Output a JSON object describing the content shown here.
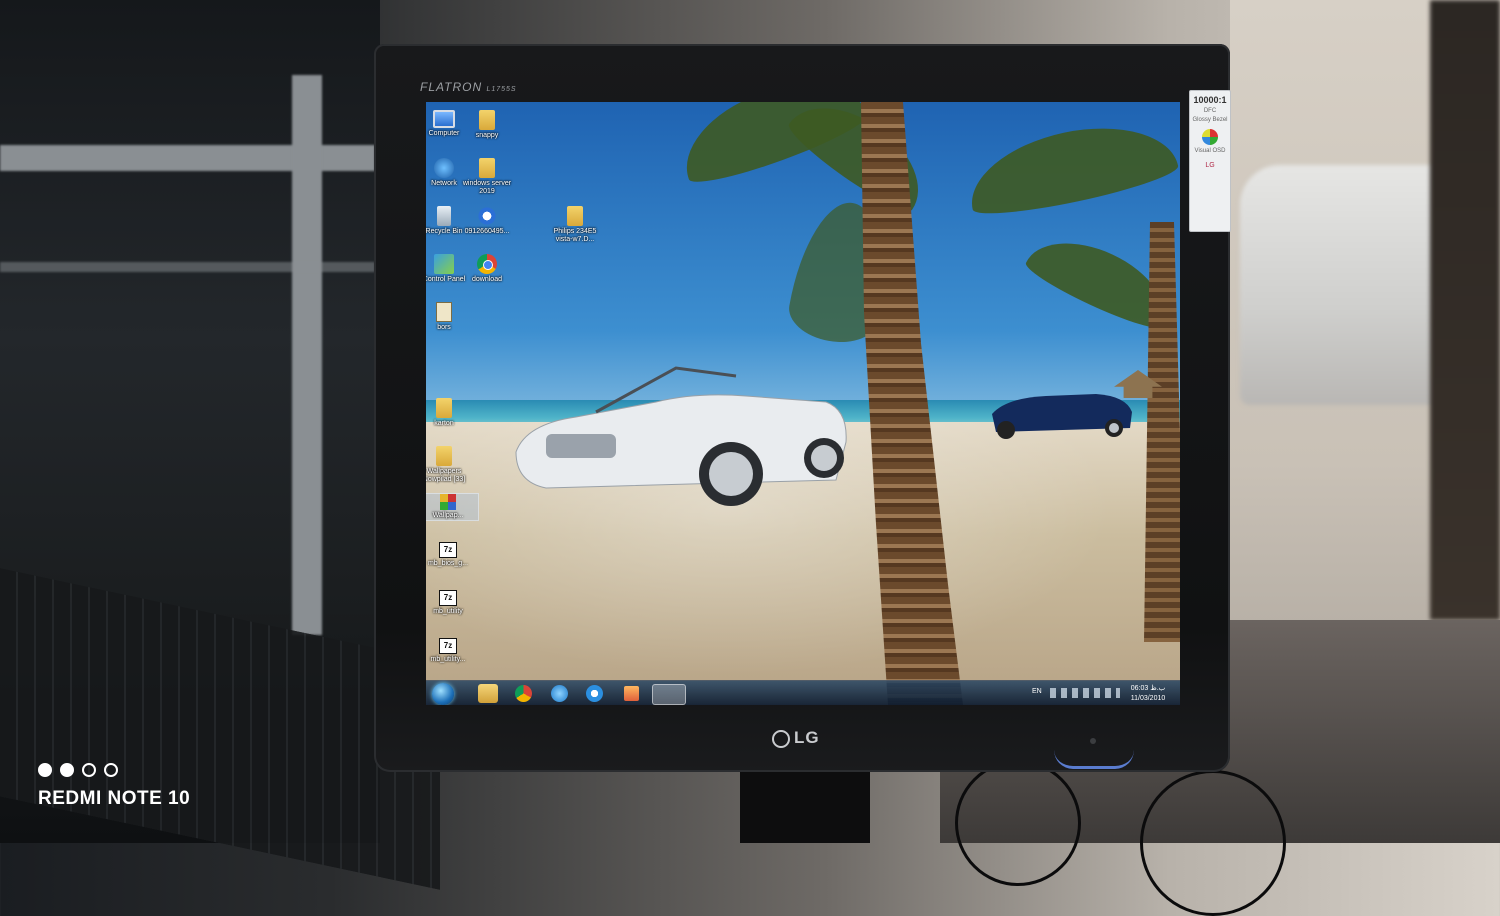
{
  "watermark": {
    "device_text": "REDMI NOTE 10"
  },
  "monitor": {
    "brand_top": "FLATRON",
    "model": "L1755S",
    "brand_bottom": "LG",
    "sticker": {
      "ratio": "10000:1",
      "lines": [
        "DFC",
        "Glossy Bezel",
        "Visual OSD"
      ],
      "brand": "LG"
    }
  },
  "desktop": {
    "icons": [
      {
        "label": "Computer",
        "icon": "computer-icon"
      },
      {
        "label": "snappy",
        "icon": "folder-icon"
      },
      {
        "label": "Network",
        "icon": "network-icon"
      },
      {
        "label": "windows server 2019",
        "icon": "folder-icon"
      },
      {
        "label": "Recycle Bin",
        "icon": "recycle-bin-icon"
      },
      {
        "label": "0912660495...",
        "icon": "app-icon"
      },
      {
        "label": "Philips 234E5 vista-w7.D...",
        "icon": "folder-icon"
      },
      {
        "label": "Control Panel",
        "icon": "control-panel-icon"
      },
      {
        "label": "download",
        "icon": "chrome-icon"
      },
      {
        "label": "bors",
        "icon": "file-icon"
      },
      {
        "label": "karton",
        "icon": "folder-icon"
      },
      {
        "label": "Wallpapers Nowpilad [33]",
        "icon": "folder-icon"
      },
      {
        "label": "Wallpap...",
        "icon": "winrar-icon"
      },
      {
        "label": "mb_bios_g...",
        "icon": "7z-icon"
      },
      {
        "label": "mb_utility",
        "icon": "7z-icon"
      },
      {
        "label": "mb_utility...",
        "icon": "7z-icon"
      }
    ],
    "sevenz_glyph": "7z"
  },
  "taskbar": {
    "language": "EN",
    "time": "06:03 ب.ظ",
    "date": "11/03/2010",
    "pinned": [
      "start-orb-icon",
      "folder-icon",
      "chrome-icon",
      "ie-icon",
      "app-icon",
      "media-player-icon",
      "display-settings-icon"
    ]
  },
  "colors": {
    "sky": "#1f63b2",
    "taskbar": "#0a192d",
    "accent": "#5a7ccf"
  }
}
